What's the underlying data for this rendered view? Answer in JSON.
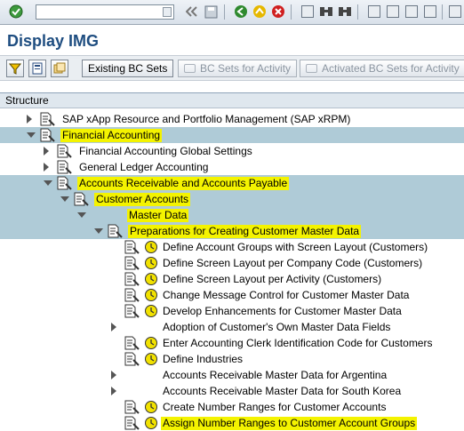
{
  "toolbar": {
    "command_field_value": ""
  },
  "title": "Display IMG",
  "app_toolbar": {
    "existing_bc_sets": "Existing BC Sets",
    "bc_sets_for_activity": "BC Sets for Activity",
    "activated_bc_sets_for_activity": "Activated BC Sets for Activity"
  },
  "structure": {
    "header": "Structure",
    "rows": [
      {
        "label": "SAP xApp Resource and Portfolio Management (SAP xRPM)",
        "level": 0,
        "toggle": "collapsed",
        "icon": "document-icon",
        "highlighted": false
      },
      {
        "label": "Financial Accounting",
        "level": 0,
        "toggle": "expanded",
        "icon": "document-icon",
        "highlighted": true
      },
      {
        "label": "Financial Accounting Global Settings",
        "level": 1,
        "toggle": "collapsed",
        "icon": "document-icon",
        "highlighted": false
      },
      {
        "label": "General Ledger Accounting",
        "level": 1,
        "toggle": "collapsed",
        "icon": "document-icon",
        "highlighted": false
      },
      {
        "label": "Accounts Receivable and Accounts Payable",
        "level": 1,
        "toggle": "expanded",
        "icon": "document-icon",
        "highlighted": true
      },
      {
        "label": "Customer Accounts",
        "level": 2,
        "toggle": "expanded",
        "icon": "document-icon",
        "highlighted": true
      },
      {
        "label": "Master Data",
        "level": 3,
        "toggle": "expanded",
        "icon": "none",
        "highlighted": true
      },
      {
        "label": "Preparations for Creating Customer Master Data",
        "level": 4,
        "toggle": "expanded",
        "icon": "document-icon",
        "highlighted": true
      },
      {
        "label": "Define Account Groups with Screen Layout (Customers)",
        "level": 5,
        "toggle": "none",
        "icon": "activity-icon",
        "highlighted": false
      },
      {
        "label": "Define Screen Layout per Company Code (Customers)",
        "level": 5,
        "toggle": "none",
        "icon": "activity-icon",
        "highlighted": false
      },
      {
        "label": "Define Screen Layout per Activity (Customers)",
        "level": 5,
        "toggle": "none",
        "icon": "activity-icon",
        "highlighted": false
      },
      {
        "label": "Change Message Control for Customer Master Data",
        "level": 5,
        "toggle": "none",
        "icon": "activity-icon",
        "highlighted": false
      },
      {
        "label": "Develop Enhancements for Customer Master Data",
        "level": 5,
        "toggle": "none",
        "icon": "activity-icon",
        "highlighted": false
      },
      {
        "label": "Adoption of Customer's Own Master Data Fields",
        "level": 5,
        "toggle": "collapsed",
        "icon": "none",
        "highlighted": false
      },
      {
        "label": "Enter Accounting Clerk Identification Code for Customers",
        "level": 5,
        "toggle": "none",
        "icon": "activity-icon",
        "highlighted": false
      },
      {
        "label": "Define Industries",
        "level": 5,
        "toggle": "none",
        "icon": "activity-icon",
        "highlighted": false
      },
      {
        "label": "Accounts Receivable Master Data for Argentina",
        "level": 5,
        "toggle": "collapsed",
        "icon": "none",
        "highlighted": false
      },
      {
        "label": "Accounts Receivable Master Data for South Korea",
        "level": 5,
        "toggle": "collapsed",
        "icon": "none",
        "highlighted": false
      },
      {
        "label": "Create Number Ranges for Customer Accounts",
        "level": 5,
        "toggle": "none",
        "icon": "activity-icon",
        "highlighted": false
      },
      {
        "label": "Assign Number Ranges to Customer Account Groups",
        "level": 5,
        "toggle": "none",
        "icon": "activity-icon",
        "highlighted": true
      }
    ]
  },
  "colors": {
    "title": "#1e4d80",
    "highlight": "#f4f300",
    "selected_row": "#afcbd7"
  }
}
